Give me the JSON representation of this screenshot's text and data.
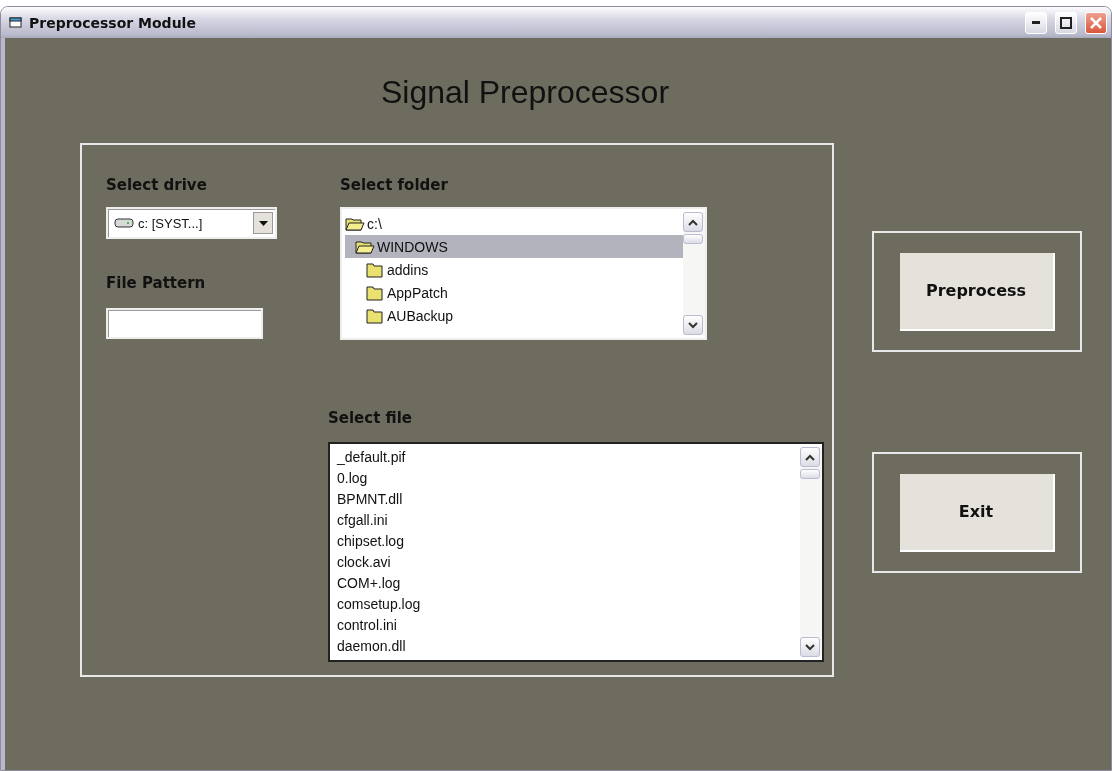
{
  "window": {
    "title": "Preprocessor Module"
  },
  "heading": "Signal Preprocessor",
  "drive": {
    "label": "Select drive",
    "value": "c: [SYST...]"
  },
  "pattern": {
    "label": "File Pattern"
  },
  "folders": {
    "label": "Select folder",
    "items": [
      {
        "name": "c:\\",
        "expanded": true,
        "selected": false,
        "children": [
          {
            "name": "WINDOWS",
            "expanded": true,
            "selected": true,
            "children": [
              {
                "name": "addins",
                "expanded": false,
                "selected": false
              },
              {
                "name": "AppPatch",
                "expanded": false,
                "selected": false
              },
              {
                "name": "AUBackup",
                "expanded": false,
                "selected": false
              }
            ]
          }
        ]
      }
    ]
  },
  "files": {
    "label": "Select file",
    "items": [
      "_default.pif",
      "0.log",
      "BPMNT.dll",
      "cfgall.ini",
      "chipset.log",
      "clock.avi",
      "COM+.log",
      "comsetup.log",
      "control.ini",
      "daemon.dll"
    ]
  },
  "buttons": [
    {
      "label": "Preprocess"
    },
    {
      "label": "Exit"
    }
  ]
}
